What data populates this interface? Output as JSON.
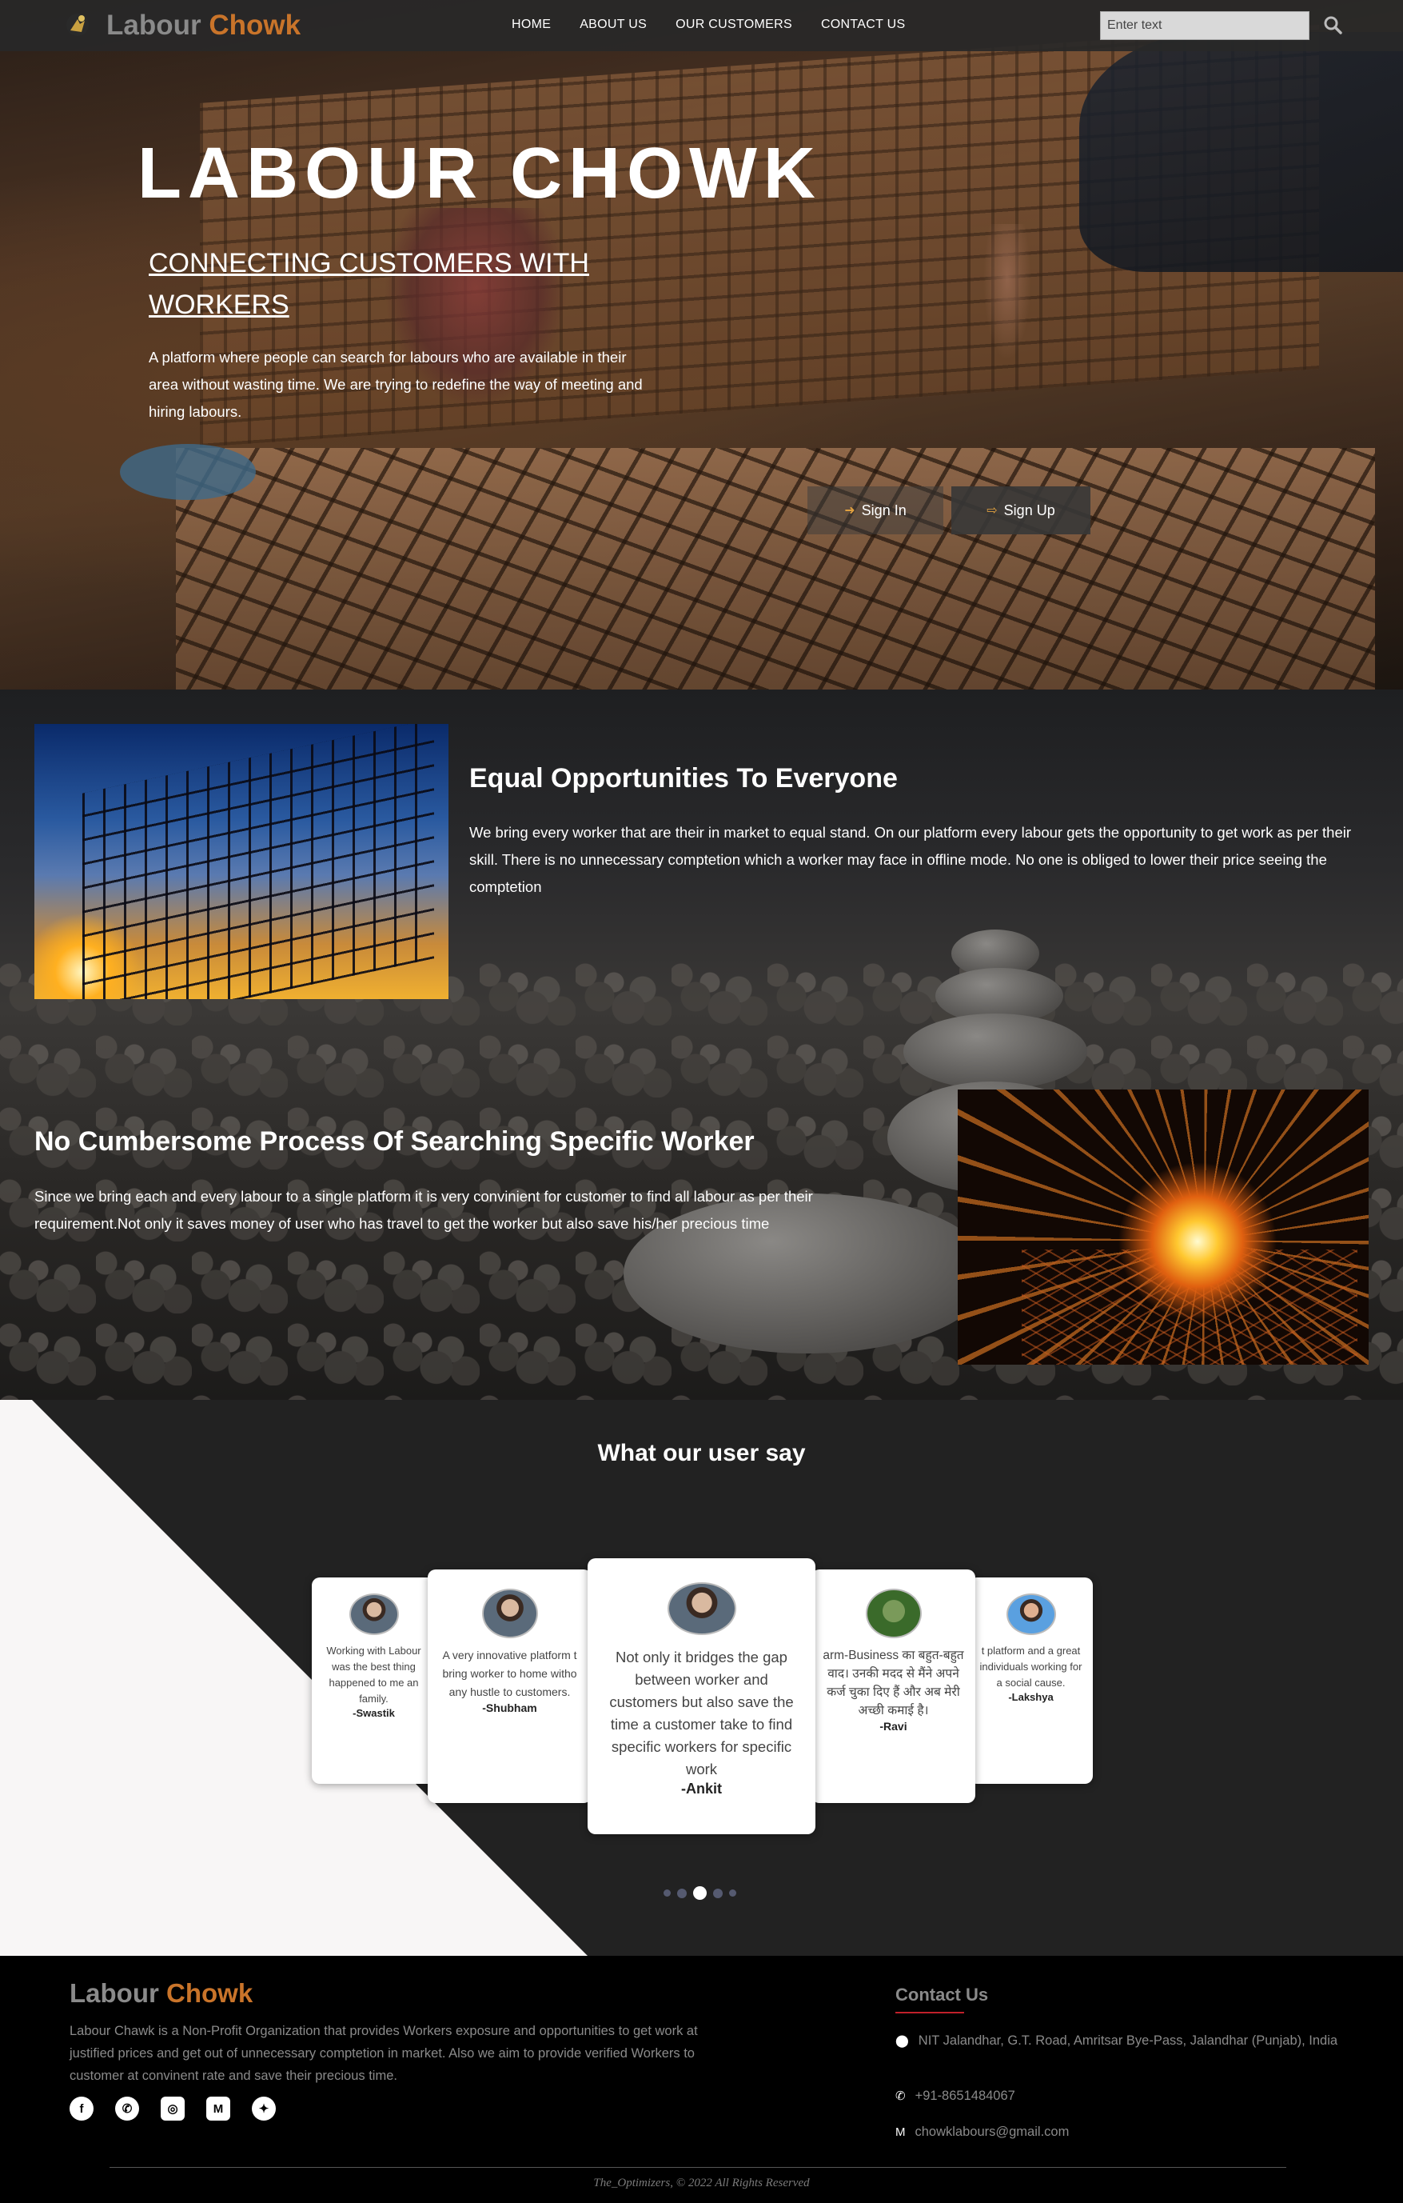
{
  "brand": {
    "name_part1": "Labour",
    "name_part2": "Chowk"
  },
  "nav": {
    "links": [
      "HOME",
      "ABOUT US",
      "OUR CUSTOMERS",
      "CONTACT US"
    ],
    "search_placeholder": "Enter text"
  },
  "hero": {
    "title": "LABOUR CHOWK",
    "subtitle": "CONNECTING CUSTOMERS WITH WORKERS",
    "description": "A platform where people can search for labours who are available in their area without wasting time. We are trying to redefine the way of meeting and hiring labours.",
    "signin_label": "Sign In",
    "signup_label": "Sign Up"
  },
  "features": [
    {
      "heading": "Equal Opportunities To Everyone",
      "text": "We bring every worker that are their in market to equal stand. On our platform every labour gets the opportunity to get work as per their skill. There is no unnecessary comptetion which a worker may face in offline mode. No one is obliged to lower their price seeing the comptetion"
    },
    {
      "heading": "No Cumbersome Process Of Searching Specific Worker",
      "text": "Since we bring each and every labour to a single platform it is very convinient for customer to find all labour as per their requirement.Not only it saves money of user who has travel to get the worker but also save his/her precious time"
    }
  ],
  "testimonials": {
    "title": "What our user say",
    "cards": [
      {
        "quote": "Working with Labour was the best thing happened to me an family.",
        "name": "-Swastik"
      },
      {
        "quote": "A very innovative platform t bring worker to home witho any hustle to customers.",
        "name": "-Shubham"
      },
      {
        "quote": "Not only it bridges the gap between worker and customers but also save the time a customer take to find specific workers for specific work",
        "name": "-Ankit"
      },
      {
        "quote": "arm-Business का बहुत-बहुत वाद। उनकी मदद से मैंने अपने कर्ज चुका दिए हैं और अब मेरी अच्छी कमाई है।",
        "name": "-Ravi"
      },
      {
        "quote": "t platform and a great individuals working for a social cause.",
        "name": "-Lakshya"
      }
    ],
    "active_index": 2
  },
  "footer": {
    "about": "Labour Chawk is a Non-Profit Organization that provides Workers exposure and opportunities to get work at justified prices and get out of unnecessary comptetion in market. Also we aim to provide verified Workers to customer at convinent rate and save their precious time.",
    "socials": [
      "facebook-icon",
      "whatsapp-icon",
      "instagram-icon",
      "gmail-icon",
      "twitter-icon"
    ],
    "contact_heading": "Contact Us",
    "address": "NIT Jalandhar, G.T. Road, Amritsar Bye-Pass, Jalandhar (Punjab), India",
    "phone": "+91-8651484067",
    "email": "chowklabours@gmail.com",
    "copyright": "The_Optimizers, © 2022 All Rights Reserved"
  },
  "colors": {
    "accent": "#c9742a",
    "contact_underline": "#c0202a",
    "nav_bg": "#282828"
  }
}
